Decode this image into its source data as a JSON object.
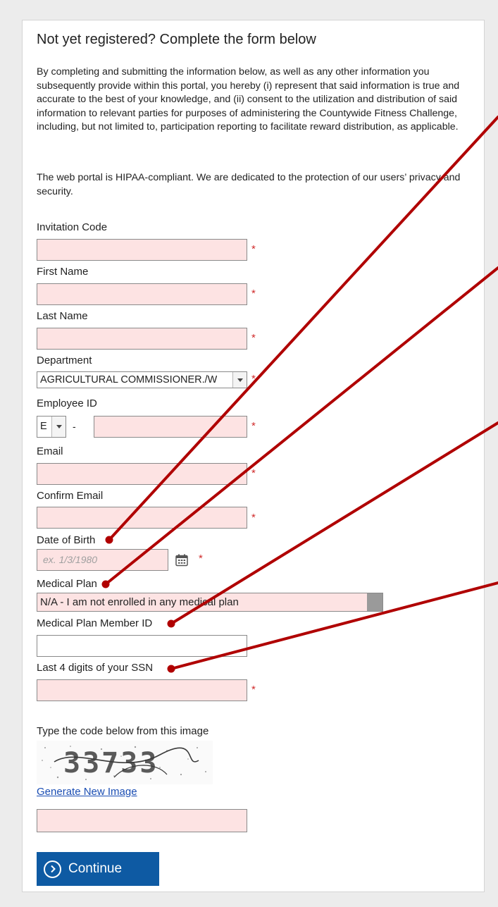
{
  "form": {
    "title": "Not yet registered? Complete the form below",
    "intro": "By completing and submitting the information below, as well as any other information you subsequently provide within this portal, you hereby (i) represent that said information is true and accurate to the best of your knowledge, and (ii) consent to the utilization and distribution of said information to relevant parties for purposes of administering the Countywide Fitness Challenge, including, but not limited to, participation reporting to facilitate reward distribution, as applicable.",
    "privacy": "The web portal is HIPAA-compliant. We are dedicated to the protection of our users’ privacy and security.",
    "required_marker": "*",
    "fields": {
      "invitation_code": {
        "label": "Invitation Code",
        "value": ""
      },
      "first_name": {
        "label": "First Name",
        "value": ""
      },
      "last_name": {
        "label": "Last Name",
        "value": ""
      },
      "department": {
        "label": "Department",
        "value": "AGRICULTURAL COMMISSIONER./W"
      },
      "employee_id": {
        "label": "Employee ID",
        "prefix": "E",
        "separator": "-",
        "value": ""
      },
      "email": {
        "label": "Email",
        "value": ""
      },
      "confirm_email": {
        "label": "Confirm Email",
        "value": ""
      },
      "date_of_birth": {
        "label": "Date of Birth",
        "placeholder": "ex. 1/3/1980"
      },
      "medical_plan": {
        "label": "Medical Plan",
        "value": "N/A - I am not enrolled in any medical plan"
      },
      "medical_plan_member_id": {
        "label": "Medical Plan Member ID",
        "value": ""
      },
      "ssn_last4": {
        "label": "Last 4 digits of your SSN",
        "value": ""
      }
    },
    "captcha": {
      "label": "Type the code below from this image",
      "code": "33733",
      "regenerate_link": "Generate New Image"
    },
    "continue_label": "Continue"
  },
  "colors": {
    "required_field_bg": "#fde3e3",
    "required_marker": "#d02b2b",
    "button_bg": "#0e5aa3",
    "link": "#1a4db3",
    "annotation_lines": "#b00000"
  },
  "icons": [
    "calendar-icon",
    "dropdown-arrow-icon",
    "chevron-right-circle-icon"
  ]
}
